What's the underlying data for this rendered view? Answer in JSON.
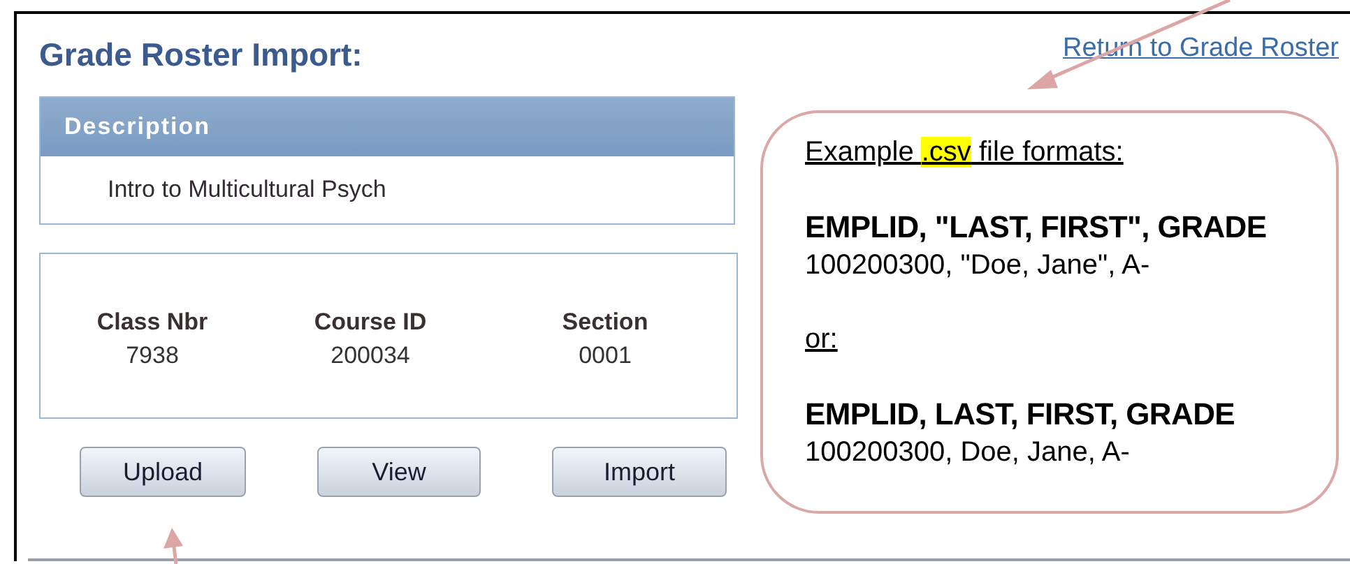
{
  "page": {
    "title": "Grade Roster Import:",
    "return_link": "Return to Grade Roster"
  },
  "description": {
    "header": "Description",
    "value": "Intro to Multicultural Psych"
  },
  "class_info": [
    {
      "label": "Class Nbr",
      "value": "7938"
    },
    {
      "label": "Course ID",
      "value": "200034"
    },
    {
      "label": "Section",
      "value": "0001"
    }
  ],
  "buttons": [
    "Upload",
    "View",
    "Import"
  ],
  "example": {
    "heading": [
      {
        "text": "Example ",
        "highlighted": false
      },
      {
        "text": ".csv",
        "highlighted": true
      },
      {
        "text": " file formats:",
        "highlighted": false
      }
    ],
    "formats": [
      {
        "header": "EMPLID, \"LAST, FIRST\", GRADE",
        "sample": "100200300, \"Doe, Jane\", A-"
      },
      {
        "header": "EMPLID, LAST, FIRST, GRADE",
        "sample": "100200300, Doe, Jane, A-"
      }
    ],
    "separator": "or:"
  }
}
